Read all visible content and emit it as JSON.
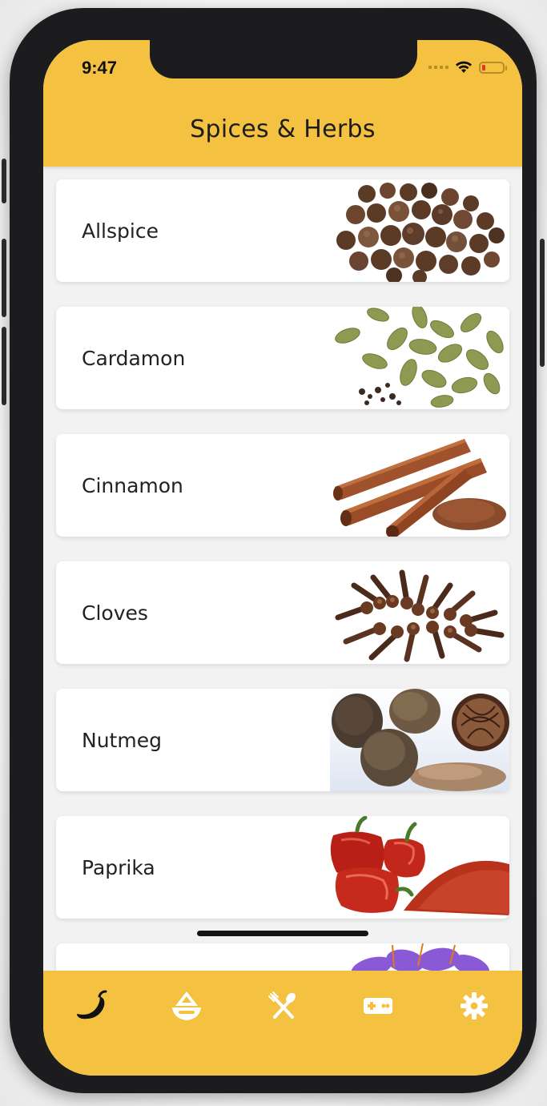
{
  "status_bar": {
    "time": "9:47"
  },
  "header": {
    "title": "Spices & Herbs",
    "background": "#f5c141"
  },
  "items": [
    {
      "label": "Allspice",
      "image": "allspice-image"
    },
    {
      "label": "Cardamon",
      "image": "cardamon-image"
    },
    {
      "label": "Cinnamon",
      "image": "cinnamon-image"
    },
    {
      "label": "Cloves",
      "image": "cloves-image"
    },
    {
      "label": "Nutmeg",
      "image": "nutmeg-image"
    },
    {
      "label": "Paprika",
      "image": "paprika-image"
    },
    {
      "label": "",
      "image": "saffron-image"
    }
  ],
  "tabbar": {
    "tabs": [
      {
        "icon": "chili-pepper-icon",
        "active": true
      },
      {
        "icon": "herbs-bowl-icon",
        "active": false
      },
      {
        "icon": "utensils-icon",
        "active": false
      },
      {
        "icon": "gamepad-icon",
        "active": false
      },
      {
        "icon": "gear-icon",
        "active": false
      }
    ],
    "active_color": "#111111",
    "inactive_color": "#ffffff"
  }
}
